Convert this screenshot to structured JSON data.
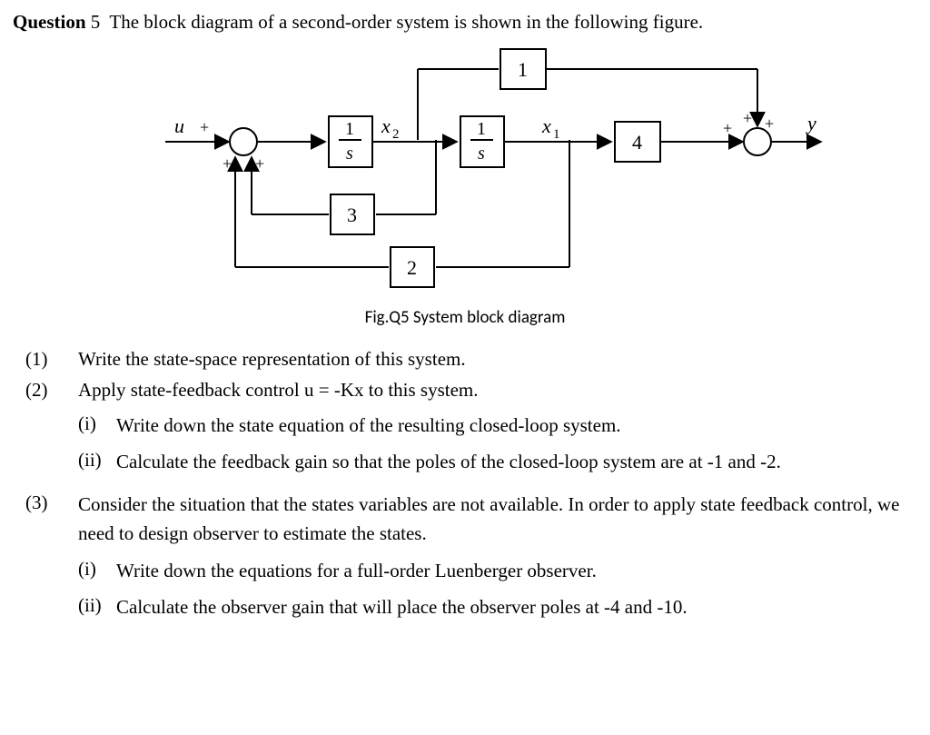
{
  "question": {
    "label": "Question",
    "number": "5",
    "prompt": "The block diagram of a second-order system is shown in the following figure."
  },
  "diagram": {
    "labels": {
      "u": "u",
      "y": "y",
      "x1": "x",
      "x1_sub": "1",
      "x2": "x",
      "x2_sub": "2",
      "plus": "+",
      "int_num": "1",
      "int_den": "s",
      "block_top": "1",
      "block_fb_inner": "3",
      "block_fb_outer": "2",
      "block_fwd": "4"
    },
    "caption": "Fig.Q5 System block diagram"
  },
  "parts": [
    {
      "num": "(1)",
      "text": "Write the state-space representation of this system."
    },
    {
      "num": "(2)",
      "text": "Apply state-feedback control u = -Kx to this system.",
      "subs": [
        {
          "num": "(i)",
          "text": "Write down the state equation of the resulting closed-loop system."
        },
        {
          "num": "(ii)",
          "text": "Calculate the feedback gain so that the poles of the closed-loop system are at -1 and -2."
        }
      ]
    },
    {
      "num": "(3)",
      "text": "Consider the situation that the states variables are not available. In order to apply state feedback control, we need to design observer to estimate the states.",
      "subs": [
        {
          "num": "(i)",
          "text": "Write down the equations for a full-order Luenberger observer."
        },
        {
          "num": "(ii)",
          "text": "Calculate the observer gain that will place the observer poles at -4 and -10."
        }
      ]
    }
  ]
}
